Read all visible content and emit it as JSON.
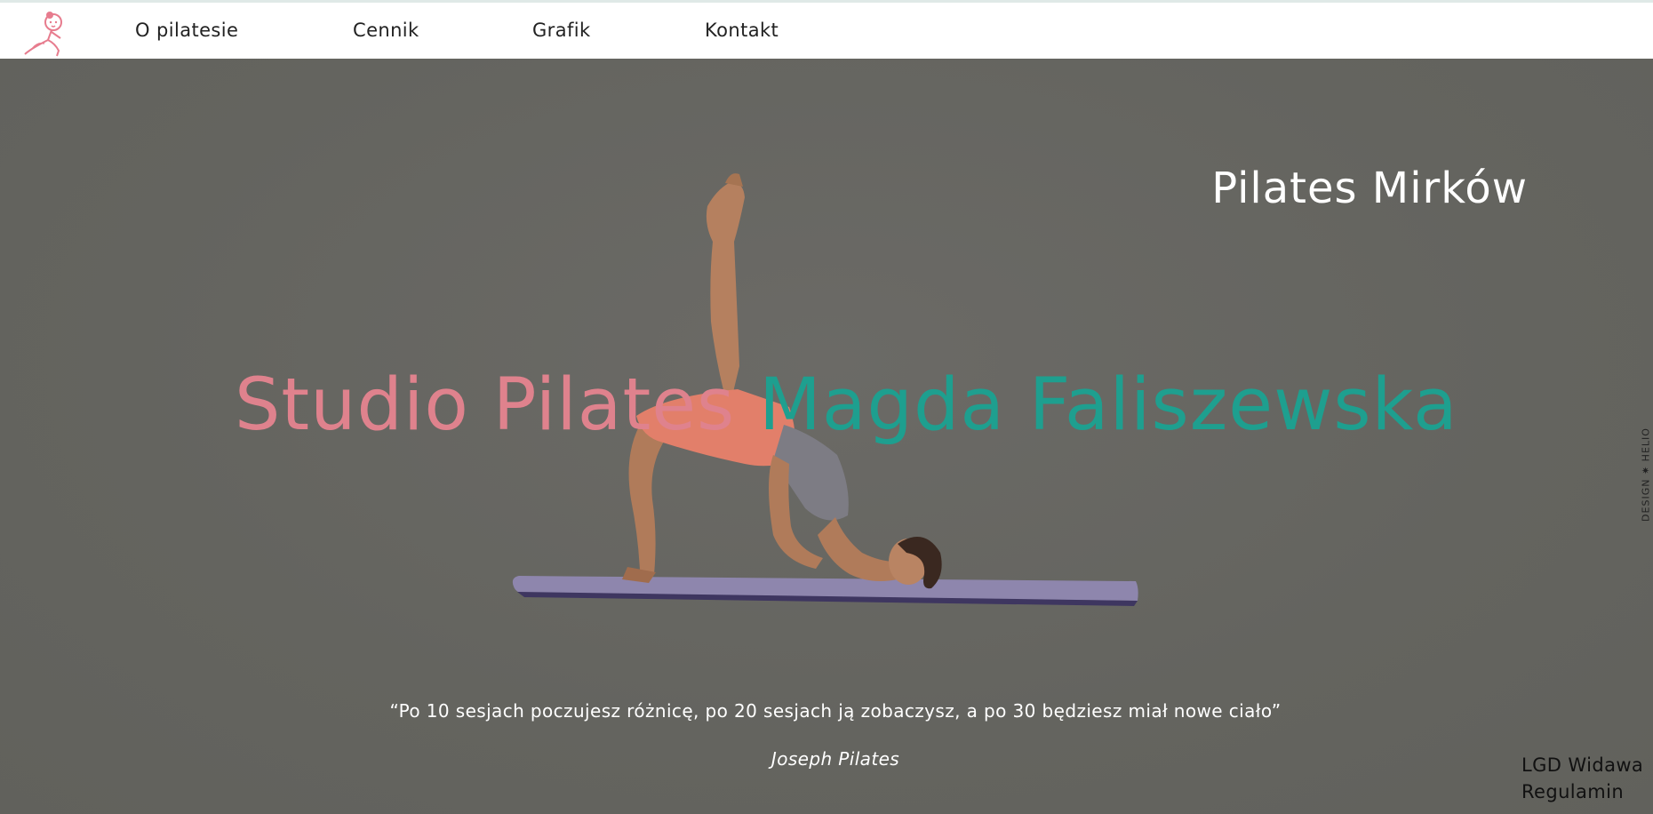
{
  "nav": {
    "logo_icon": "pilates-girl-logo-icon",
    "links": [
      "O pilatesie",
      "Cennik",
      "Grafik",
      "Kontakt"
    ]
  },
  "hero": {
    "location_title": "Pilates Mirków",
    "studio_title_pink": "Studio Pilates ",
    "studio_title_teal": "Magda Faliszewska",
    "quote": "“Po 10 sesjach poczujesz różnicę, po 20 sesjach ją zobaczysz, a po 30 będziesz miał nowe ciało”",
    "quote_author": "Joseph Pilates"
  },
  "side_credit": "DESIGN ✷ HELIO",
  "footer": {
    "links": [
      "LGD Widawa",
      "Regulamin"
    ]
  },
  "colors": {
    "accent_pink": "#df828d",
    "accent_teal": "#1e9f8f",
    "hero_background": "#64645f",
    "nav_background": "#ffffff"
  }
}
